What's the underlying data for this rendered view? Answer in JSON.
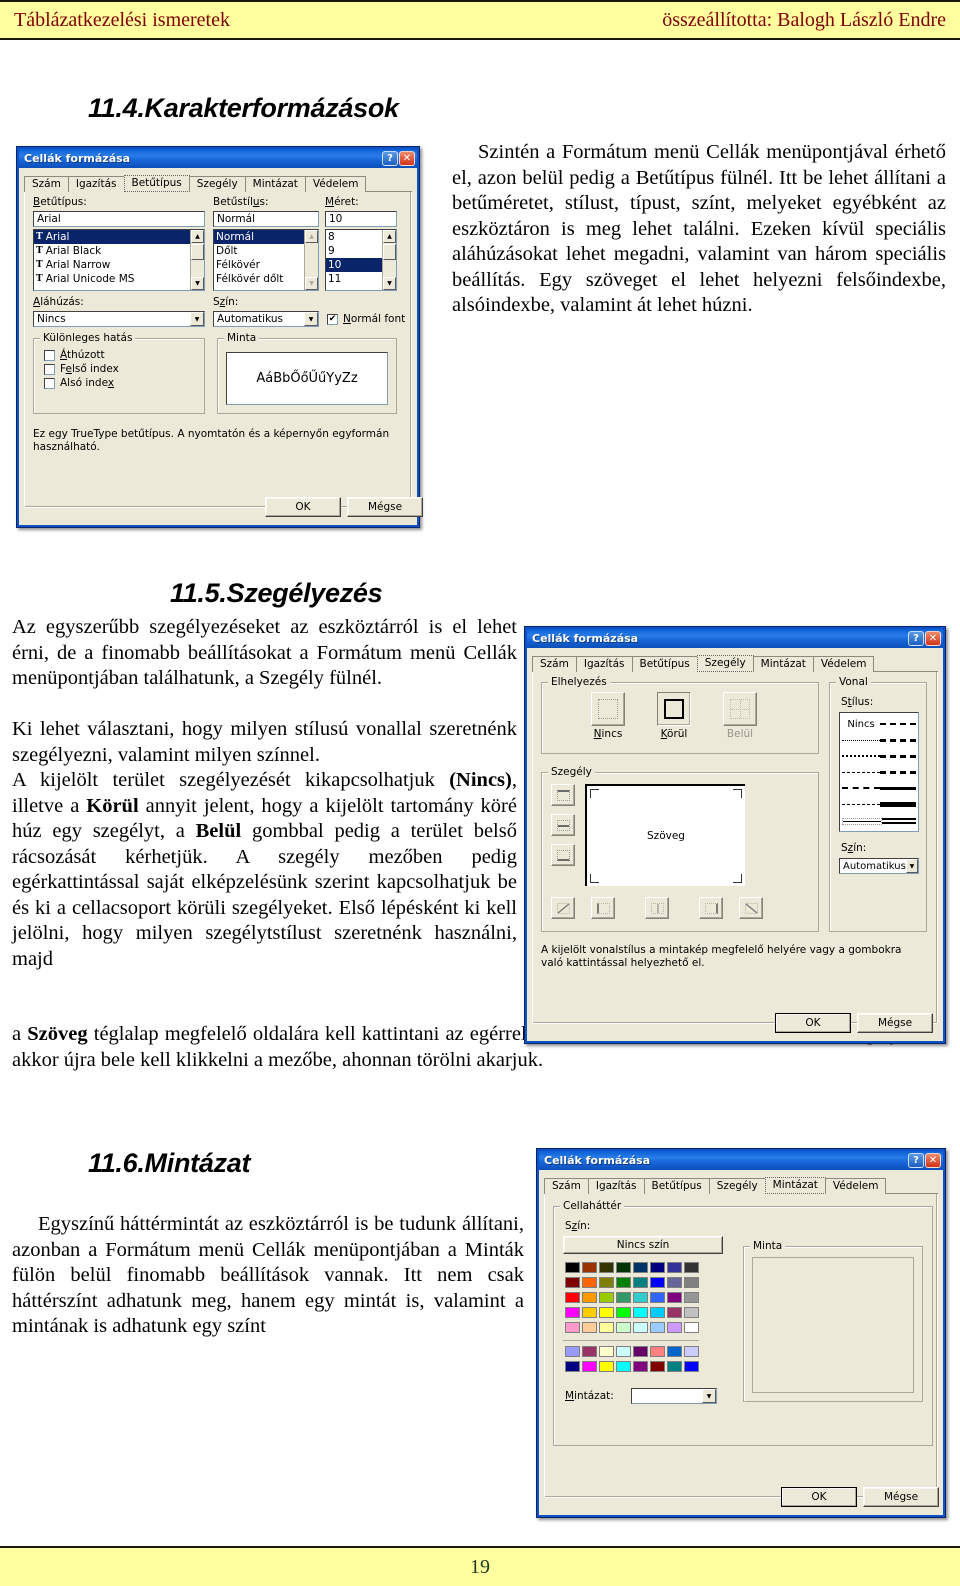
{
  "header": {
    "left": "Táblázatkezelési  ismeretek",
    "right": "összeállította: Balogh László Endre",
    "bg": "#ffffa0",
    "text_color": "#800000"
  },
  "footer": {
    "page_number": "19",
    "text_color": "#1d3b1d"
  },
  "sections": [
    {
      "number_title": "11.4.Karakterformázások",
      "paragraph": "Szintén a Formátum menü Cellák menüpontjával érhető el, azon belül pedig a Betűtípus fülnél. Itt be lehet állítani a betűméretet, stílust, típust, színt, melyeket egyébként az eszköztáron is meg lehet találni. Ezeken kívül speciális aláhúzásokat lehet megadni, valamint van három speciális beállítás. Egy szöveget el lehet helyezni felsőindexbe, alsóindexbe, valamint át lehet húzni."
    },
    {
      "number_title": "11.5.Szegélyezés",
      "para1": "Az egyszerűbb szegélyezéseket az eszköztárról is el lehet érni, de a finomabb beállításokat a Formátum menü Cellák menüpontjában találhatunk, a Szegély fülnél.",
      "para2_a": "Ki lehet választani, hogy milyen stílusú vonallal szeretnénk szegélyezni, valamint milyen színnel.",
      "para3_a": "A kijelölt terület szegélyezését kikapcsolhatjuk ",
      "para3_b1": "(Nincs)",
      "para3_c": ", illetve a ",
      "para3_b2": "Körül",
      "para3_d": " annyit jelent, hogy a kijelölt tartomány köré húz egy szegélyt, a ",
      "para3_b3": "Belül",
      "para3_e": " gombbal pedig a terület belső rácsozását kérhetjük. A szegély mezőben pedig egérkattintással saját elképzelésünk szerint kapcsolhatjuk be és ki a cellacsoport körüli szegélyeket. Első lépésként ki kell jelölni, hogy milyen szegélytstílust szeretnénk használni, majd",
      "para4_a": "a ",
      "para4_b": "Szöveg",
      "para4_c": " téglalap megfelelő oldalára kell kattintani az egérrel. Ha valahonnan szeretnénk törölni a szegélyezést, akkor újra bele kell klikkelni a mezőbe, ahonnan törölni akarjuk."
    },
    {
      "number_title": "11.6.Mintázat",
      "paragraph": "Egyszínű háttérmintát az eszköztárról is be tudunk állítani, azonban a Formátum menü Cellák menüpontjában a Minták fülön belül finomabb beállítások vannak. Itt nem csak háttérszínt adhatunk meg, hanem egy mintát is, valamint a mintának is adhatunk egy színt"
    }
  ],
  "dialog_common": {
    "title": "Cellák formázása",
    "help_button": "?",
    "close_button": "✕",
    "tabs": [
      "Szám",
      "Igazítás",
      "Betűtípus",
      "Szegély",
      "Mintázat",
      "Védelem"
    ],
    "ok": "OK",
    "cancel": "Mégse"
  },
  "font_dialog": {
    "selected_tab": "Betűtípus",
    "font_label": "Betűtípus:",
    "font_value": "Arial",
    "font_list": [
      "Arial",
      "Arial Black",
      "Arial Narrow",
      "Arial Unicode MS"
    ],
    "font_selected_index": 0,
    "style_label": "Betűstílus:",
    "style_value": "Normál",
    "style_list": [
      "Normál",
      "Dőlt",
      "Félkövér",
      "Félkövér dőlt"
    ],
    "style_selected_index": 0,
    "size_label": "Méret:",
    "size_value": "10",
    "size_list": [
      "8",
      "9",
      "10",
      "11"
    ],
    "size_selected_index": 2,
    "underline_label": "Aláhúzás:",
    "underline_value": "Nincs",
    "color_label": "Szín:",
    "color_value": "Automatikus",
    "normal_font_label": "Normál font",
    "normal_font_checked": true,
    "effects_group": "Különleges hatás",
    "effects": [
      {
        "label": "Áthúzott",
        "checked": false
      },
      {
        "label": "Felső index",
        "checked": false
      },
      {
        "label": "Alsó index",
        "checked": false
      }
    ],
    "preview_group": "Minta",
    "preview_text": "AáBbŐőŰűYyZz",
    "note": "Ez egy TrueType betűtípus.  A nyomtatón és a képernyőn egyformán használható."
  },
  "border_dialog": {
    "selected_tab": "Szegély",
    "placement_group": "Elhelyezés",
    "presets": [
      "Nincs",
      "Körül",
      "Belül"
    ],
    "preset_selected": "Körül",
    "border_group": "Szegély",
    "preview_text": "Szöveg",
    "line_group": "Vonal",
    "style_label": "Stílus:",
    "style_none": "Nincs",
    "color_label": "Szín:",
    "color_value": "Automatikus",
    "note": "A kijelölt vonalstílus a mintakép megfelelő helyére vagy a gombokra való kattintással helyezhető el."
  },
  "pattern_dialog": {
    "selected_tab": "Mintázat",
    "cell_bg_group": "Cellaháttér",
    "color_label": "Szín:",
    "no_color_button": "Nincs szín",
    "pattern_label": "Mintázat:",
    "pattern_value": "",
    "sample_group": "Minta",
    "palette_rows": [
      [
        "#000000",
        "#993300",
        "#333300",
        "#003300",
        "#003366",
        "#000080",
        "#333399",
        "#333333"
      ],
      [
        "#800000",
        "#FF6600",
        "#808000",
        "#008000",
        "#008080",
        "#0000FF",
        "#666699",
        "#808080"
      ],
      [
        "#FF0000",
        "#FF9900",
        "#99CC00",
        "#339966",
        "#33CCCC",
        "#3366FF",
        "#800080",
        "#969696"
      ],
      [
        "#FF00FF",
        "#FFCC00",
        "#FFFF00",
        "#00FF00",
        "#00FFFF",
        "#00CCFF",
        "#993366",
        "#C0C0C0"
      ],
      [
        "#FF99CC",
        "#FFCC99",
        "#FFFF99",
        "#CCFFCC",
        "#CCFFFF",
        "#99CCFF",
        "#CC99FF",
        "#FFFFFF"
      ]
    ],
    "palette_rows2": [
      [
        "#9999FF",
        "#993366",
        "#FFFFCC",
        "#CCFFFF",
        "#660066",
        "#FF8080",
        "#0066CC",
        "#CCCCFF"
      ],
      [
        "#000080",
        "#FF00FF",
        "#FFFF00",
        "#00FFFF",
        "#800080",
        "#800000",
        "#008080",
        "#0000FF"
      ]
    ]
  }
}
